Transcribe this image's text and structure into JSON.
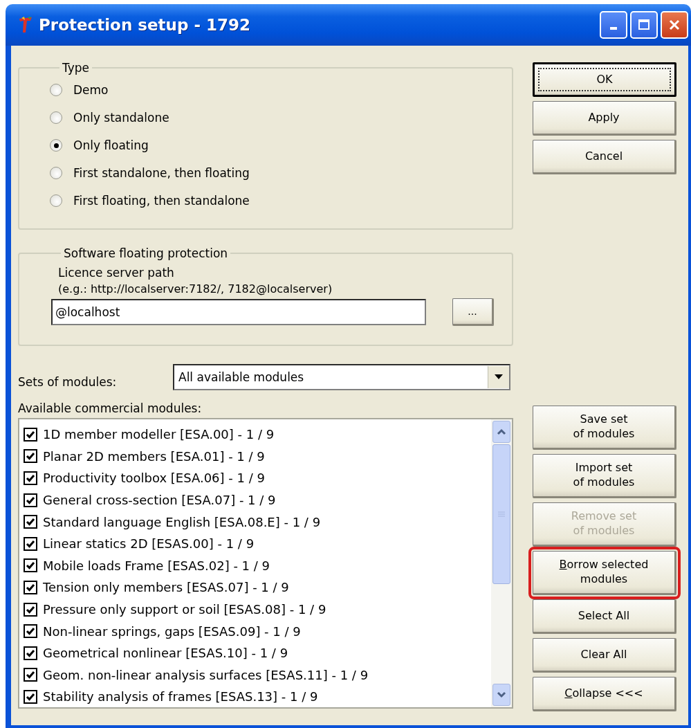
{
  "window": {
    "title": "Protection setup - 1792"
  },
  "type_group": {
    "legend": "Type",
    "options": [
      {
        "label": "Demo",
        "selected": false
      },
      {
        "label": "Only standalone",
        "selected": false
      },
      {
        "label": "Only floating",
        "selected": true
      },
      {
        "label": "First standalone, then floating",
        "selected": false
      },
      {
        "label": "First floating, then standalone",
        "selected": false
      }
    ]
  },
  "floating_group": {
    "legend": "Software floating protection",
    "label": "Licence server path",
    "hint": "(e.g.: http://localserver:7182/, 7182@localserver)",
    "path_value": "@localhost",
    "browse_button": "..."
  },
  "sets": {
    "label": "Sets of modules:",
    "value": "All available modules"
  },
  "modules": {
    "label": "Available commercial modules:",
    "items": [
      {
        "label": "1D member modeller [ESA.00] - 1 / 9",
        "checked": true
      },
      {
        "label": "Planar 2D members [ESA.01] - 1 / 9",
        "checked": true
      },
      {
        "label": "Productivity toolbox [ESA.06] - 1 / 9",
        "checked": true
      },
      {
        "label": "General cross-section [ESA.07] - 1 / 9",
        "checked": true
      },
      {
        "label": "Standard language English [ESA.08.E] - 1 / 9",
        "checked": true
      },
      {
        "label": "Linear statics 2D [ESAS.00] - 1 / 9",
        "checked": true
      },
      {
        "label": "Mobile loads Frame [ESAS.02] - 1 / 9",
        "checked": true
      },
      {
        "label": "Tension only members [ESAS.07] - 1 / 9",
        "checked": true
      },
      {
        "label": "Pressure only support or soil [ESAS.08] - 1 / 9",
        "checked": true
      },
      {
        "label": "Non-linear springs, gaps [ESAS.09] - 1 / 9",
        "checked": true
      },
      {
        "label": "Geometrical nonlinear [ESAS.10] - 1 / 9",
        "checked": true
      },
      {
        "label": "Geom. non-linear analysis surfaces [ESAS.11] - 1 / 9",
        "checked": true
      },
      {
        "label": "Stability analysis of frames [ESAS.13] - 1 / 9",
        "checked": true
      }
    ]
  },
  "top_buttons": [
    {
      "label": "OK",
      "focused": true,
      "disabled": false,
      "highlighted": false,
      "underline_first": false
    },
    {
      "label": "Apply",
      "focused": false,
      "disabled": false,
      "highlighted": false,
      "underline_first": false
    },
    {
      "label": "Cancel",
      "focused": false,
      "disabled": false,
      "highlighted": false,
      "underline_first": false
    }
  ],
  "side_buttons": [
    {
      "label": "Save set\nof modules",
      "focused": false,
      "disabled": false,
      "highlighted": false,
      "underline_first": false
    },
    {
      "label": "Import set\nof modules",
      "focused": false,
      "disabled": false,
      "highlighted": false,
      "underline_first": false
    },
    {
      "label": "Remove set\nof modules",
      "focused": false,
      "disabled": true,
      "highlighted": false,
      "underline_first": false
    },
    {
      "label": "Borrow selected\nmodules",
      "focused": false,
      "disabled": false,
      "highlighted": true,
      "underline_first": true
    },
    {
      "label": "Select All",
      "focused": false,
      "disabled": false,
      "highlighted": false,
      "underline_first": false
    },
    {
      "label": "Clear All",
      "focused": false,
      "disabled": false,
      "highlighted": false,
      "underline_first": false
    },
    {
      "label": "Collapse <<<",
      "focused": false,
      "disabled": false,
      "highlighted": false,
      "underline_first": true
    }
  ]
}
